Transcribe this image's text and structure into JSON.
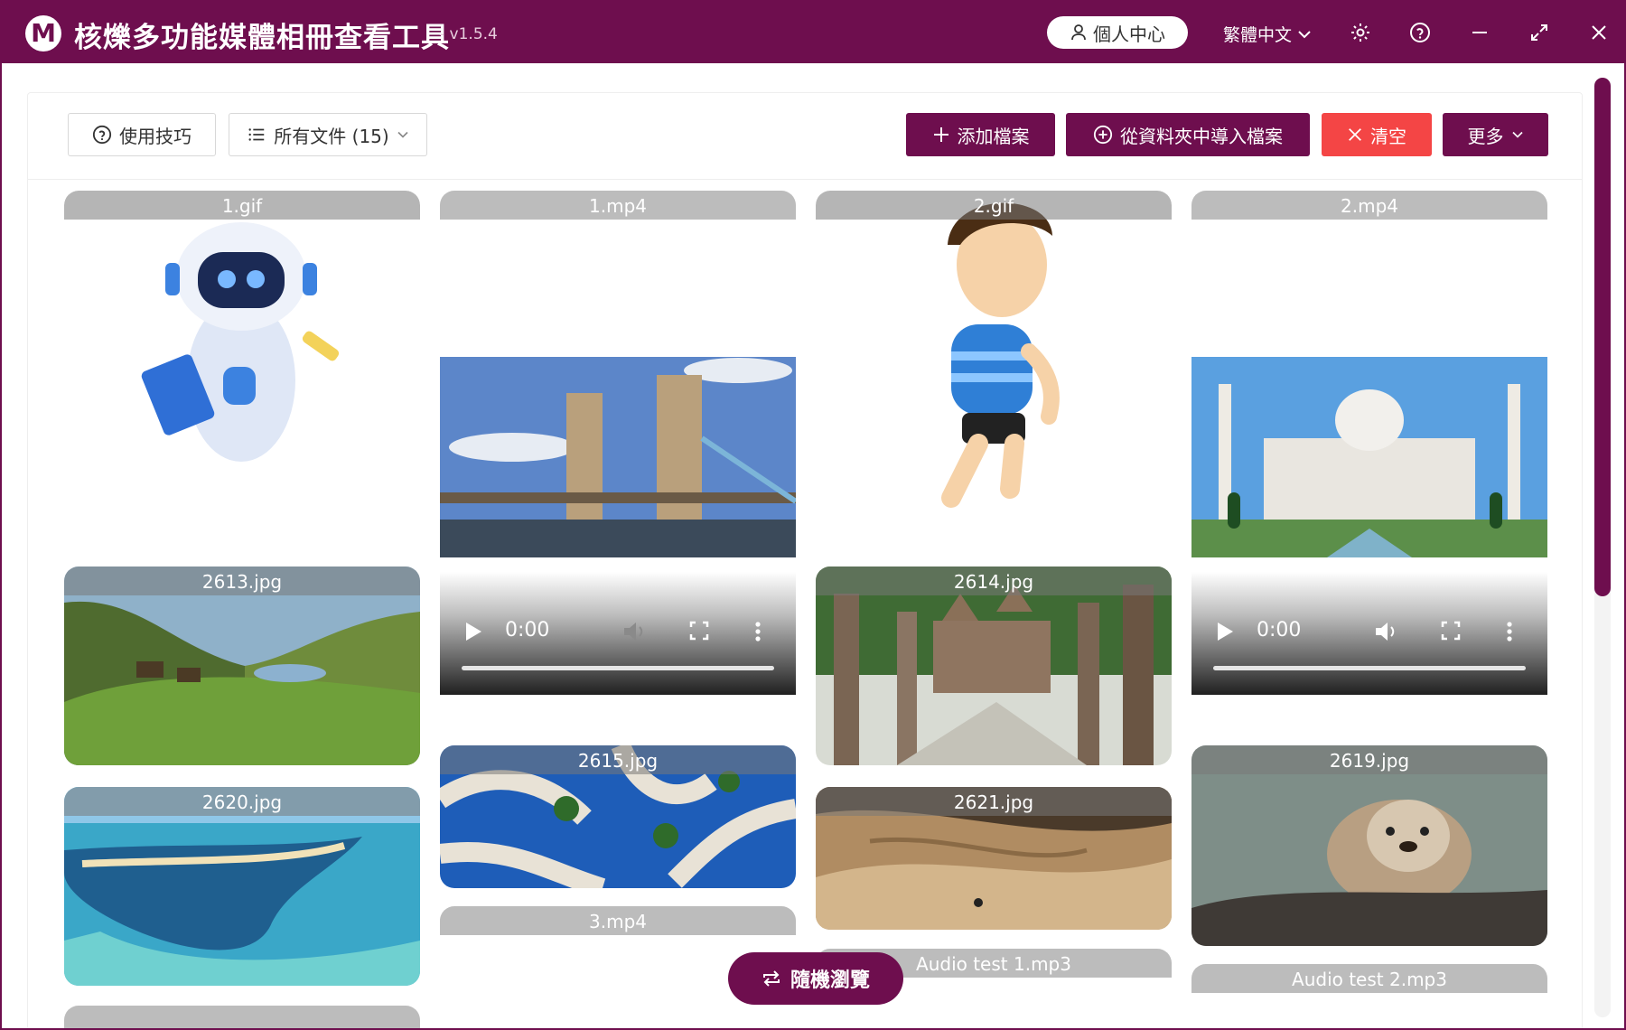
{
  "titlebar": {
    "logo_letter": "M",
    "title": "核爍多功能媒體相冊查看工具",
    "version": "- v1.5.4",
    "profile": "個人中心",
    "language": "繁體中文"
  },
  "toolbar": {
    "tips": "使用技巧",
    "filter": "所有文件 (15)",
    "add_file": "添加檔案",
    "import_folder": "從資料夾中導入檔案",
    "clear": "清空",
    "more": "更多"
  },
  "tiles": {
    "t1": "1.gif",
    "t2": "1.mp4",
    "t3": "2.gif",
    "t4": "2.mp4",
    "t5": "2613.jpg",
    "t6": "2614.jpg",
    "t7": "2615.jpg",
    "t8": "2619.jpg",
    "t9": "2620.jpg",
    "t10": "2621.jpg",
    "t11": "3.mp4",
    "t12": "Audio test 1.mp3",
    "t13": "Audio test 2.mp3"
  },
  "video": {
    "time": "0:00"
  },
  "random_browse": "隨機瀏覽",
  "colors": {
    "brand": "#6e0e4e",
    "danger": "#f44545"
  }
}
